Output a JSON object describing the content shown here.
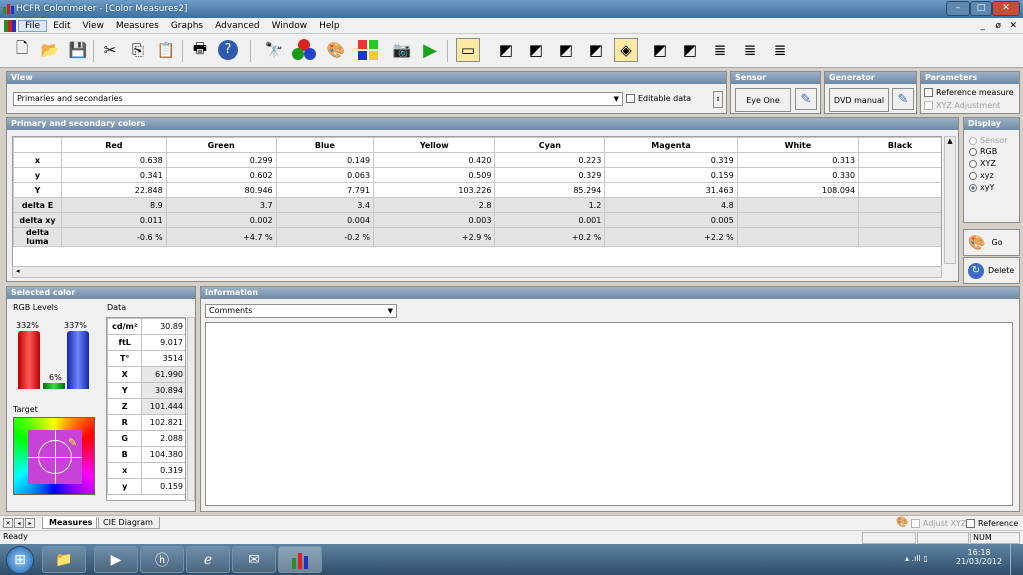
{
  "window": {
    "title": "HCFR Colorimeter - [Color Measures2]",
    "min_label": "–",
    "max_label": "□",
    "close_label": "✕",
    "doc_min": "_",
    "doc_restore": "ø",
    "doc_close": "✕"
  },
  "menu": [
    "File",
    "Edit",
    "View",
    "Measures",
    "Graphs",
    "Advanced",
    "Window",
    "Help"
  ],
  "toolbar": {
    "group1": [
      "new-icon",
      "open-icon",
      "save-icon",
      "cut-icon",
      "copy-icon",
      "paste-icon",
      "print-icon",
      "help-icon"
    ],
    "group2": [
      "sensor-icon",
      "generator-icon",
      "palette-icon",
      "colors-icon",
      "camera-icon",
      "play-icon"
    ],
    "group3": [
      "measure-view-icon",
      "luminance-graph-icon",
      "gamma-graph-icon",
      "rgb-histogram-icon",
      "color-temp-icon",
      "cie-chart-icon",
      "near-black-icon",
      "near-white-icon",
      "saturation-shift-icon",
      "saturation-sat-icon",
      "saturation-all-icon"
    ]
  },
  "view": {
    "header": "View",
    "combo_value": "Primaries and secondaries",
    "editable_data": "Editable data"
  },
  "sensor": {
    "header": "Sensor",
    "value": "Eye One"
  },
  "generator": {
    "header": "Generator",
    "value": "DVD manual"
  },
  "parameters": {
    "header": "Parameters",
    "reference_measure": "Reference measure",
    "xyz_adjustment": "XYZ Adjustment"
  },
  "primary": {
    "header": "Primary and secondary colors",
    "columns": [
      "",
      "Red",
      "Green",
      "Blue",
      "Yellow",
      "Cyan",
      "Magenta",
      "White",
      "Black"
    ],
    "rows": [
      {
        "label": "x",
        "values": [
          "0.638",
          "0.299",
          "0.149",
          "0.420",
          "0.223",
          "0.319",
          "0.313",
          ""
        ]
      },
      {
        "label": "y",
        "values": [
          "0.341",
          "0.602",
          "0.063",
          "0.509",
          "0.329",
          "0.159",
          "0.330",
          ""
        ]
      },
      {
        "label": "Y",
        "values": [
          "22.848",
          "80.946",
          "7.791",
          "103.226",
          "85.294",
          "31.463",
          "108.094",
          ""
        ]
      },
      {
        "label": "delta E",
        "values": [
          "8.9",
          "3.7",
          "3.4",
          "2.8",
          "1.2",
          "4.8",
          "",
          ""
        ]
      },
      {
        "label": "delta xy",
        "values": [
          "0.011",
          "0.002",
          "0.004",
          "0.003",
          "0.001",
          "0.005",
          "",
          ""
        ]
      },
      {
        "label": "delta luma",
        "values": [
          "-0.6 %",
          "+4.7 %",
          "-0.2 %",
          "+2.9 %",
          "+0.2 %",
          "+2.2 %",
          "",
          ""
        ]
      }
    ]
  },
  "display": {
    "header": "Display",
    "options": [
      "Sensor",
      "RGB",
      "XYZ",
      "xyz",
      "xyY"
    ],
    "selected": "xyY",
    "go": "Go",
    "delete": "Delete"
  },
  "selected": {
    "header": "Selected color",
    "rgb_levels": "RGB Levels",
    "data": "Data",
    "red_level": "332%",
    "blue_level": "337%",
    "green_level": "6%",
    "target": "Target",
    "table": [
      {
        "k": "cd/m²",
        "v": "30.89"
      },
      {
        "k": "ftL",
        "v": "9.017"
      },
      {
        "k": "T°",
        "v": "3514"
      },
      {
        "k": "X",
        "v": "61.990"
      },
      {
        "k": "Y",
        "v": "30.894"
      },
      {
        "k": "Z",
        "v": "101.444"
      },
      {
        "k": "R",
        "v": "102.821"
      },
      {
        "k": "G",
        "v": "2.088"
      },
      {
        "k": "B",
        "v": "104.380"
      },
      {
        "k": "x",
        "v": "0.319"
      },
      {
        "k": "y",
        "v": "0.159"
      }
    ]
  },
  "information": {
    "header": "Information",
    "combo_value": "Comments"
  },
  "tabs": [
    "Measures",
    "CIE Diagram"
  ],
  "bottom": {
    "adjust_xyz": "Adjust XYZ",
    "reference": "Reference"
  },
  "status": {
    "text": "Ready",
    "num": "NUM"
  },
  "taskbar": {
    "time": "16:18",
    "date": "21/03/2012",
    "apps": [
      "hp-icon",
      "ie-icon",
      "explorer-icon",
      "media-icon",
      "outlook-icon",
      "hcfr-icon"
    ]
  }
}
